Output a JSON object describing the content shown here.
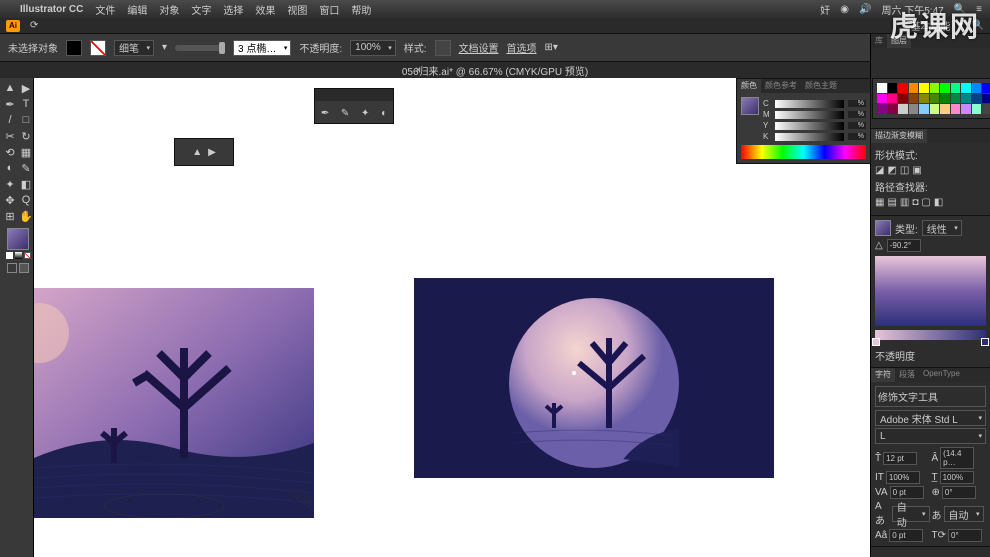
{
  "mac": {
    "app": "Illustrator CC",
    "menus": [
      "文件",
      "编辑",
      "对象",
      "文字",
      "选择",
      "效果",
      "视图",
      "窗口",
      "帮助"
    ],
    "clock": "周六 下午5:47"
  },
  "app": {
    "logo": "Ai",
    "essentials": "基本功能"
  },
  "ctrl": {
    "label": "未选择对象",
    "brush_label": "细笔",
    "stroke_val": "3 点椭…",
    "opacity_label": "不透明度:",
    "opacity_val": "100%",
    "style_label": "样式:",
    "docset": "文档设置",
    "prefs": "首选项"
  },
  "tab": {
    "title": "056归来.ai* @ 66.67% (CMYK/GPU 预览)"
  },
  "tools": [
    "▲",
    "▶",
    "✒",
    "T",
    "/",
    "□",
    "✂",
    "↻",
    "⟲",
    "▦",
    "◐",
    "✎",
    "✦",
    "◧",
    "✥",
    "Q",
    "⊞",
    "✋"
  ],
  "colorpanel": {
    "tabs": [
      "颜色",
      "颜色参考",
      "颜色主题"
    ],
    "channels": [
      {
        "l": "C",
        "v": "%"
      },
      {
        "l": "M",
        "v": "%"
      },
      {
        "l": "Y",
        "v": "%"
      },
      {
        "l": "K",
        "v": "%"
      }
    ]
  },
  "right": {
    "libs": "库",
    "layers": "图层",
    "transp_title": "描边渐变模糊",
    "shape_title": "形状模式:",
    "pathfinder_title": "路径查找器:",
    "grad_type_label": "类型:",
    "grad_type_val": "线性",
    "grad_angle": "-90.2°",
    "grad_edit": "不透明度",
    "char_tab": "字符",
    "para_tab": "段落",
    "ot_tab": "OpenType",
    "touch": "修饰文字工具",
    "font": "Adobe 宋体 Std L",
    "size": "12 pt",
    "leading": "(14.4 p…",
    "tracking": "100%",
    "baseline": "100%",
    "kerning": "0 pt",
    "vshift": "0°",
    "auto": "自动",
    "auto2": "自动"
  },
  "swcolors": [
    "#fff",
    "#000",
    "#e00",
    "#f80",
    "#ff0",
    "#8f0",
    "#0f0",
    "#0f8",
    "#0ff",
    "#08f",
    "#00f",
    "#80f",
    "#f0f",
    "#f08",
    "#800",
    "#840",
    "#880",
    "#480",
    "#080",
    "#084",
    "#088",
    "#048",
    "#008",
    "#408",
    "#808",
    "#804",
    "#ccc",
    "#888",
    "#8cf",
    "#cf8",
    "#fc8",
    "#f8c",
    "#c8f",
    "#8fc",
    "#444",
    "#222"
  ]
}
